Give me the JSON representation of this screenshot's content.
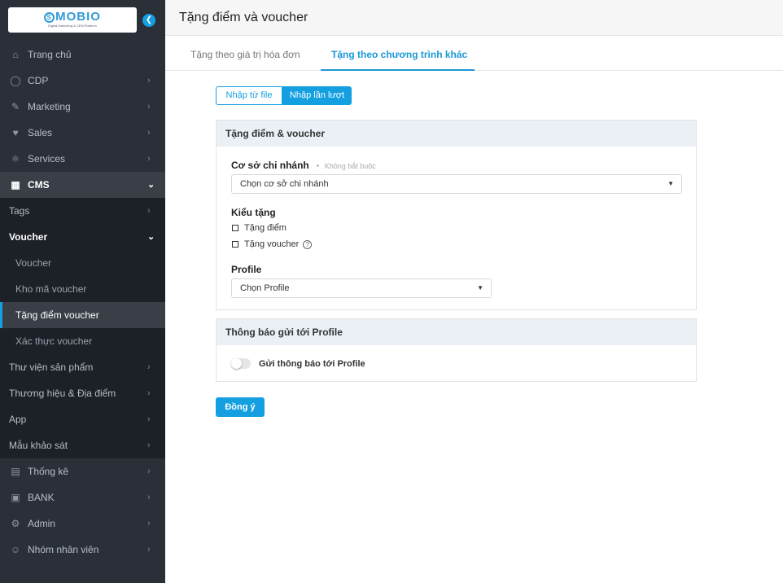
{
  "brand": {
    "name": "MOBIO",
    "tagline": "Digital Marketing & CEM Platform"
  },
  "sidebar": {
    "items": [
      {
        "label": "Trang chủ",
        "icon": "home-icon"
      },
      {
        "label": "CDP",
        "icon": "user-icon"
      },
      {
        "label": "Marketing",
        "icon": "megaphone-icon"
      },
      {
        "label": "Sales",
        "icon": "handshake-icon"
      },
      {
        "label": "Services",
        "icon": "services-icon"
      },
      {
        "label": "CMS",
        "icon": "cms-icon"
      },
      {
        "label": "Tags"
      },
      {
        "label": "Voucher"
      },
      {
        "label": "Voucher"
      },
      {
        "label": "Kho mã voucher"
      },
      {
        "label": "Tặng điểm voucher"
      },
      {
        "label": "Xác thực voucher"
      },
      {
        "label": "Thư viện sản phẩm"
      },
      {
        "label": "Thương hiệu & Địa điểm"
      },
      {
        "label": "App"
      },
      {
        "label": "Mẫu khảo sát"
      },
      {
        "label": "Thống kê",
        "icon": "chart-icon"
      },
      {
        "label": "BANK",
        "icon": "bank-icon"
      },
      {
        "label": "Admin",
        "icon": "gear-icon"
      },
      {
        "label": "Nhóm nhân viên",
        "icon": "team-icon"
      }
    ]
  },
  "header": {
    "title": "Tặng điểm và voucher"
  },
  "tabs": [
    {
      "label": "Tặng theo giá trị hóa đơn"
    },
    {
      "label": "Tặng theo chương trình khác"
    }
  ],
  "input_mode": {
    "from_file": "Nhập từ file",
    "sequential": "Nhập lần lượt"
  },
  "form": {
    "section_title": "Tặng điểm & voucher",
    "branch_label": "Cơ sở chi nhánh",
    "branch_optional": "Không bắt buộc",
    "branch_placeholder": "Chọn cơ sở chi nhánh",
    "gift_type_label": "Kiểu tặng",
    "gift_points": "Tặng điểm",
    "gift_voucher": "Tặng voucher",
    "profile_label": "Profile",
    "profile_placeholder": "Chọn Profile"
  },
  "notification": {
    "section_title": "Thông báo gửi tới Profile",
    "toggle_label": "Gửi thông báo tới Profile"
  },
  "submit_label": "Đồng ý",
  "colors": {
    "accent": "#139fe0",
    "sidebar_bg": "#2b3038"
  }
}
